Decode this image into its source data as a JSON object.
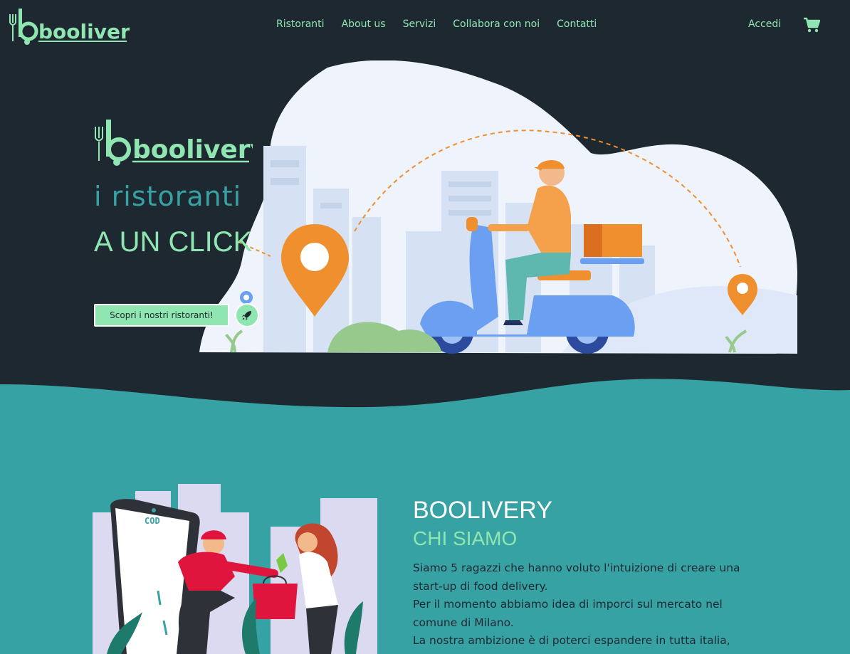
{
  "brand": {
    "name": "boolivery"
  },
  "nav": {
    "links": [
      "Ristoranti",
      "About us",
      "Servizi",
      "Collabora con noi",
      "Contatti"
    ],
    "login": "Accedi",
    "cart_icon": "cart-icon"
  },
  "hero": {
    "tagline": "i ristoranti",
    "headline": "A UN CLICK",
    "cta_label": "Scopri i nostri ristoranti!",
    "cta_icon": "rocket-icon"
  },
  "about": {
    "title": "BOOLIVERY",
    "subtitle": "CHI SIAMO",
    "paragraphs": [
      "Siamo 5 ragazzi che hanno voluto l'intuizione di creare una start-up di food delivery.",
      "Per il momento abbiamo idea di imporci sul mercato nel comune di Milano.",
      "La nostra ambizione è di poterci espandere in tutta italia,"
    ],
    "illustration_text": "COD"
  },
  "colors": {
    "dark": "#1e2830",
    "accent_green": "#8fe6b1",
    "teal": "#37a2a4",
    "orange": "#f08f2e",
    "blue": "#6a9ff2"
  }
}
